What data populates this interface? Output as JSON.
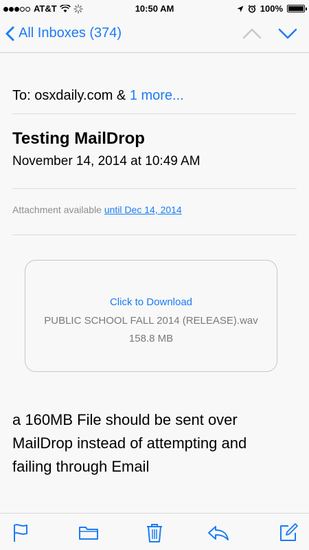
{
  "status_bar": {
    "carrier": "AT&T",
    "time": "10:50 AM",
    "battery": "100%",
    "battery_fill": 1.0
  },
  "nav": {
    "back_label": "All Inboxes (374)",
    "icons": [
      "chevron-left-icon",
      "chevron-up-icon",
      "chevron-down-icon"
    ]
  },
  "email": {
    "to_label": "To: osxdaily.com &",
    "to_more": "1 more...",
    "subject": "Testing MailDrop",
    "date": "November 14, 2014 at 10:49 AM",
    "attachment_note": "Attachment available",
    "attachment_until": "until Dec 14, 2014",
    "download": {
      "link": "Click to Download",
      "filename": "PUBLIC SCHOOL FALL 2014 (RELEASE).wav",
      "size": "158.8 MB"
    },
    "body": "a 160MB File should be sent over MailDrop instead of attempting and failing through Email"
  },
  "toolbar": {
    "icons": [
      "flag-icon",
      "folder-icon",
      "trash-icon",
      "reply-icon",
      "compose-icon"
    ]
  },
  "colors": {
    "accent": "#1a7cf5",
    "background": "#f8f8f8",
    "secondary_text": "#8e8e8e"
  }
}
